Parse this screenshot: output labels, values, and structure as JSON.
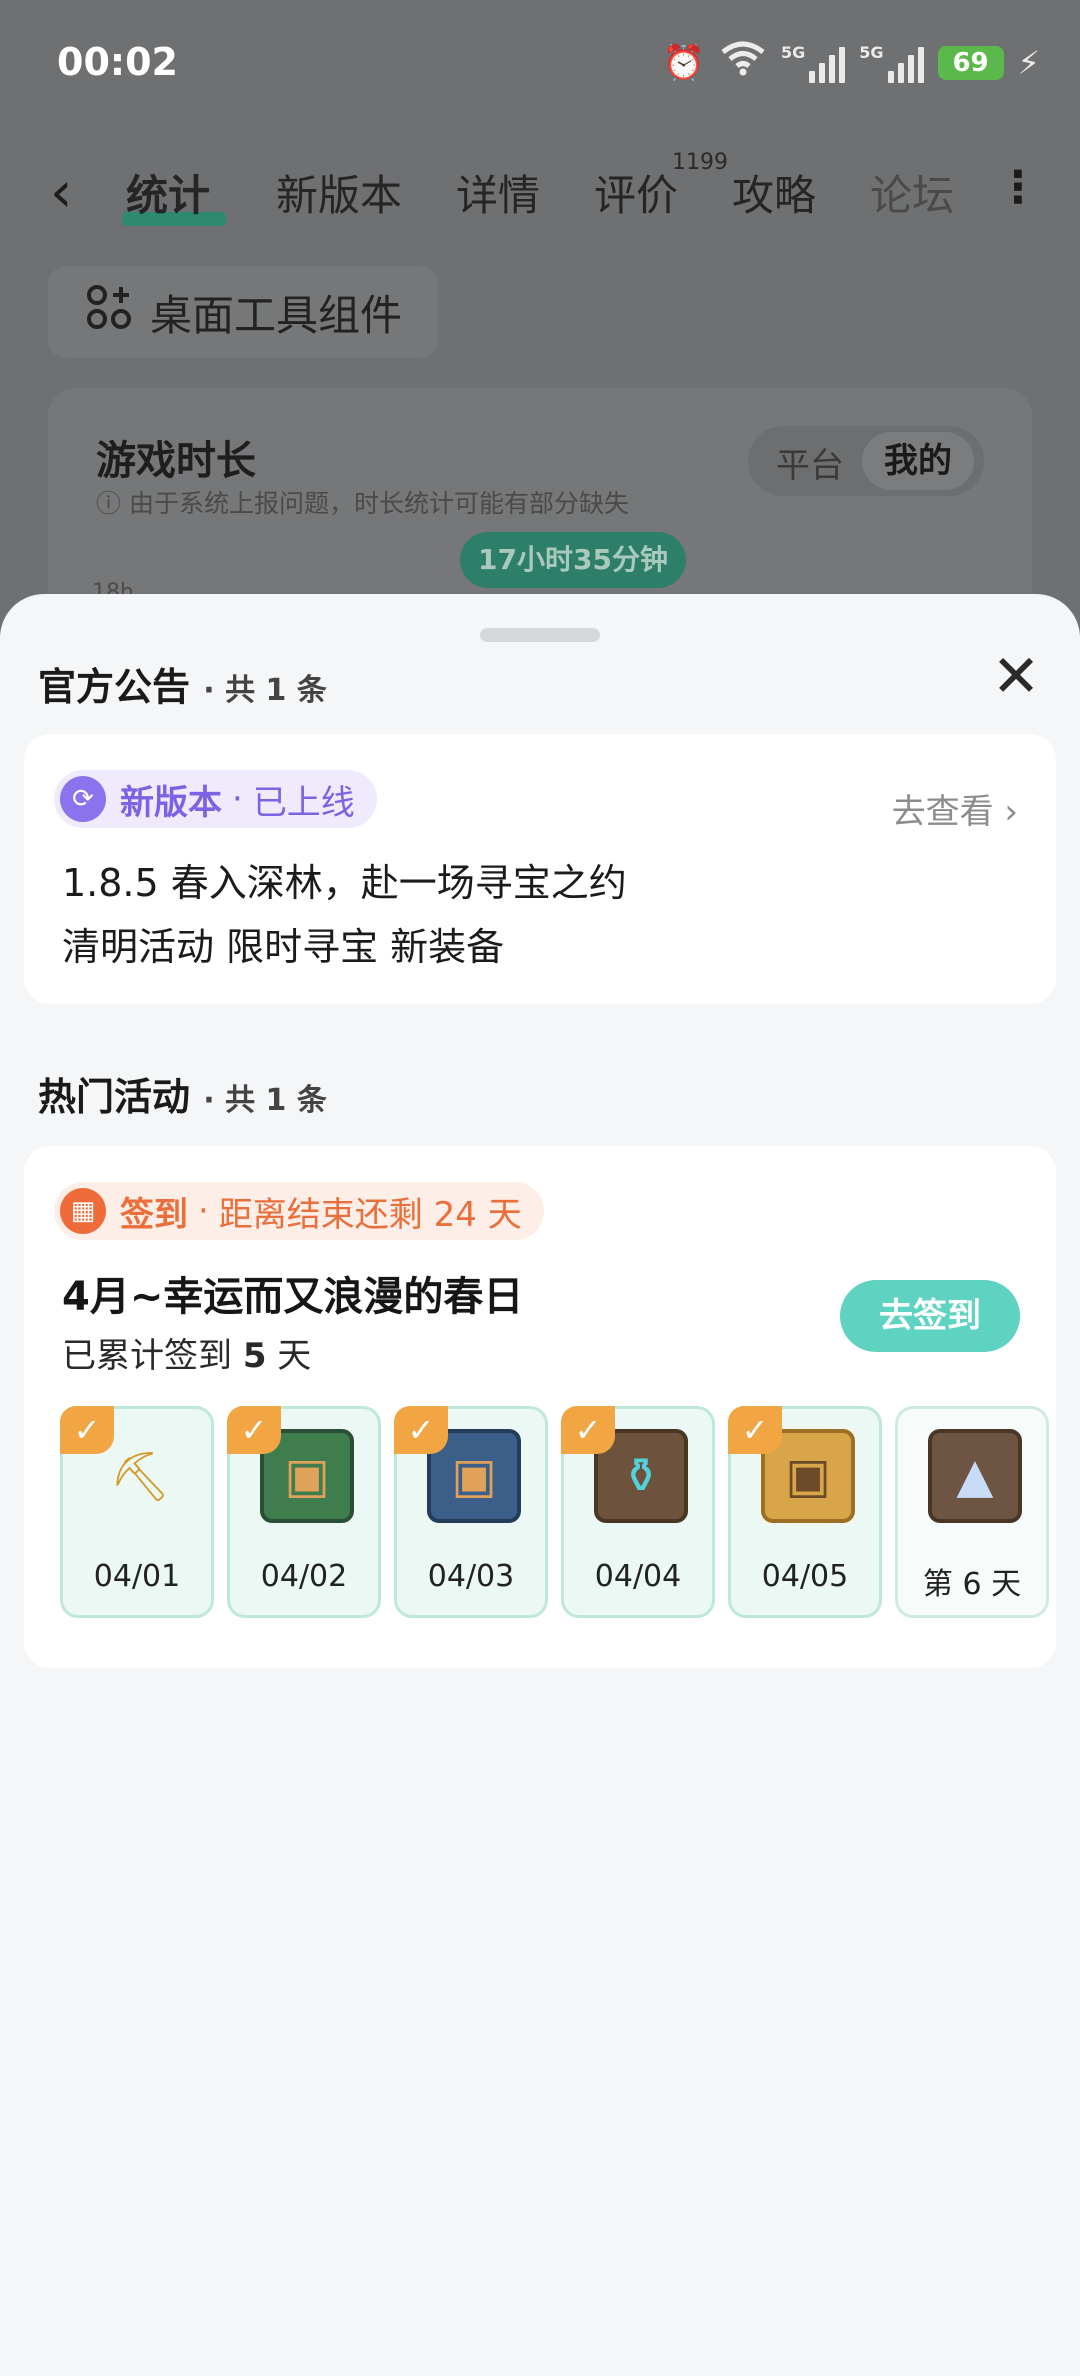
{
  "status_bar": {
    "time": "00:02",
    "signal_label_1": "5G",
    "signal_label_2": "5G",
    "battery": "69",
    "icons": [
      "alarm-icon",
      "wifi-icon",
      "signal-icon",
      "signal-icon",
      "battery-icon",
      "charging-icon"
    ]
  },
  "nav": {
    "tabs": [
      "统计",
      "新版本",
      "详情",
      "评价",
      "攻略",
      "论坛"
    ],
    "active_tab": "统计",
    "review_count": "1199"
  },
  "widget_chip": {
    "label": "桌面工具组件"
  },
  "stats": {
    "title": "游戏时长",
    "note": "由于系统上报问题，时长统计可能有部分缺失",
    "toggle": [
      "平台",
      "我的"
    ],
    "toggle_selected": "我的",
    "total_time": "17小时35分钟",
    "axis_label": "18h"
  },
  "sheet": {
    "announcements": {
      "title": "官方公告",
      "count": "共 1 条",
      "pill_main": "新版本",
      "pill_status": "已上线",
      "link": "去查看",
      "line1": "1.8.5 春入深林，赴一场寻宝之约",
      "line2": "清明活动 限时寻宝 新装备"
    },
    "activities": {
      "title": "热门活动",
      "count": "共 1 条",
      "pill_main": "签到",
      "pill_status": "距离结束还剩 24 天",
      "event_title": "4月~幸运而又浪漫的春日",
      "progress_prefix": "已累计签到",
      "progress_days": "5",
      "progress_suffix": "天",
      "button": "去签到",
      "days": [
        {
          "label": "04/01",
          "checked": true,
          "item": "gold-ore-icon"
        },
        {
          "label": "04/02",
          "checked": true,
          "item": "treasure-chest-icon"
        },
        {
          "label": "04/03",
          "checked": true,
          "item": "treasure-chest-icon"
        },
        {
          "label": "04/04",
          "checked": true,
          "item": "potion-icon"
        },
        {
          "label": "04/05",
          "checked": true,
          "item": "treasure-chest-icon"
        },
        {
          "label": "第 6 天",
          "checked": false,
          "item": "crystal-icon"
        }
      ]
    }
  },
  "colors": {
    "accent_green": "#2d8a6e",
    "signin_button": "#5ed3c2",
    "version_purple": "#7c63e3",
    "signin_orange": "#ea6f3a",
    "check_orange": "#f1a643"
  }
}
